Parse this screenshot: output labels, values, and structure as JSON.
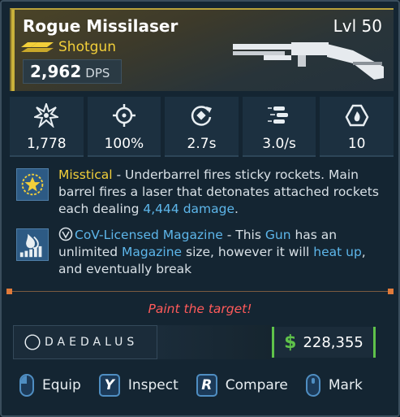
{
  "item": {
    "name": "Rogue Missilaser",
    "level": "Lvl 50",
    "type": "Shotgun",
    "dps_value": "2,962",
    "dps_unit": "DPS"
  },
  "stats": [
    {
      "icon": "damage-burst-icon",
      "value": "1,778"
    },
    {
      "icon": "crosshair-icon",
      "value": "100%"
    },
    {
      "icon": "reload-icon",
      "value": "2.7s"
    },
    {
      "icon": "fire-rate-icon",
      "value": "3.0/s"
    },
    {
      "icon": "magazine-icon",
      "value": "10"
    }
  ],
  "perks": [
    {
      "name": "Misstical",
      "text_1": " - Underbarrel fires sticky rockets. Main barrel fires a laser that detonates attached rockets each dealing ",
      "highlight": "4,444 damage",
      "text_2": "."
    },
    {
      "name": "CoV-Licensed Magazine",
      "text_1": " - This ",
      "kw_gun": "Gun",
      "text_2": " has an unlimited ",
      "kw_magazine": "Magazine",
      "text_3": " size, however it will ",
      "kw_heat": "heat up",
      "text_4": ", and eventually break"
    }
  ],
  "flavor": "Paint the target!",
  "manufacturer": "DAEDALUS",
  "price": {
    "symbol": "$",
    "value": "228,355"
  },
  "controls": [
    {
      "key": "",
      "icon": "mouse-left-icon",
      "label": "Equip"
    },
    {
      "key": "Y",
      "icon": "",
      "label": "Inspect"
    },
    {
      "key": "R",
      "icon": "",
      "label": "Compare"
    },
    {
      "key": "",
      "icon": "mouse-middle-icon",
      "label": "Mark"
    }
  ],
  "colors": {
    "rarity": "#f2cf3a",
    "keyword": "#5db6ea",
    "flavor": "#ff5a5a",
    "price": "#5fc24a"
  }
}
